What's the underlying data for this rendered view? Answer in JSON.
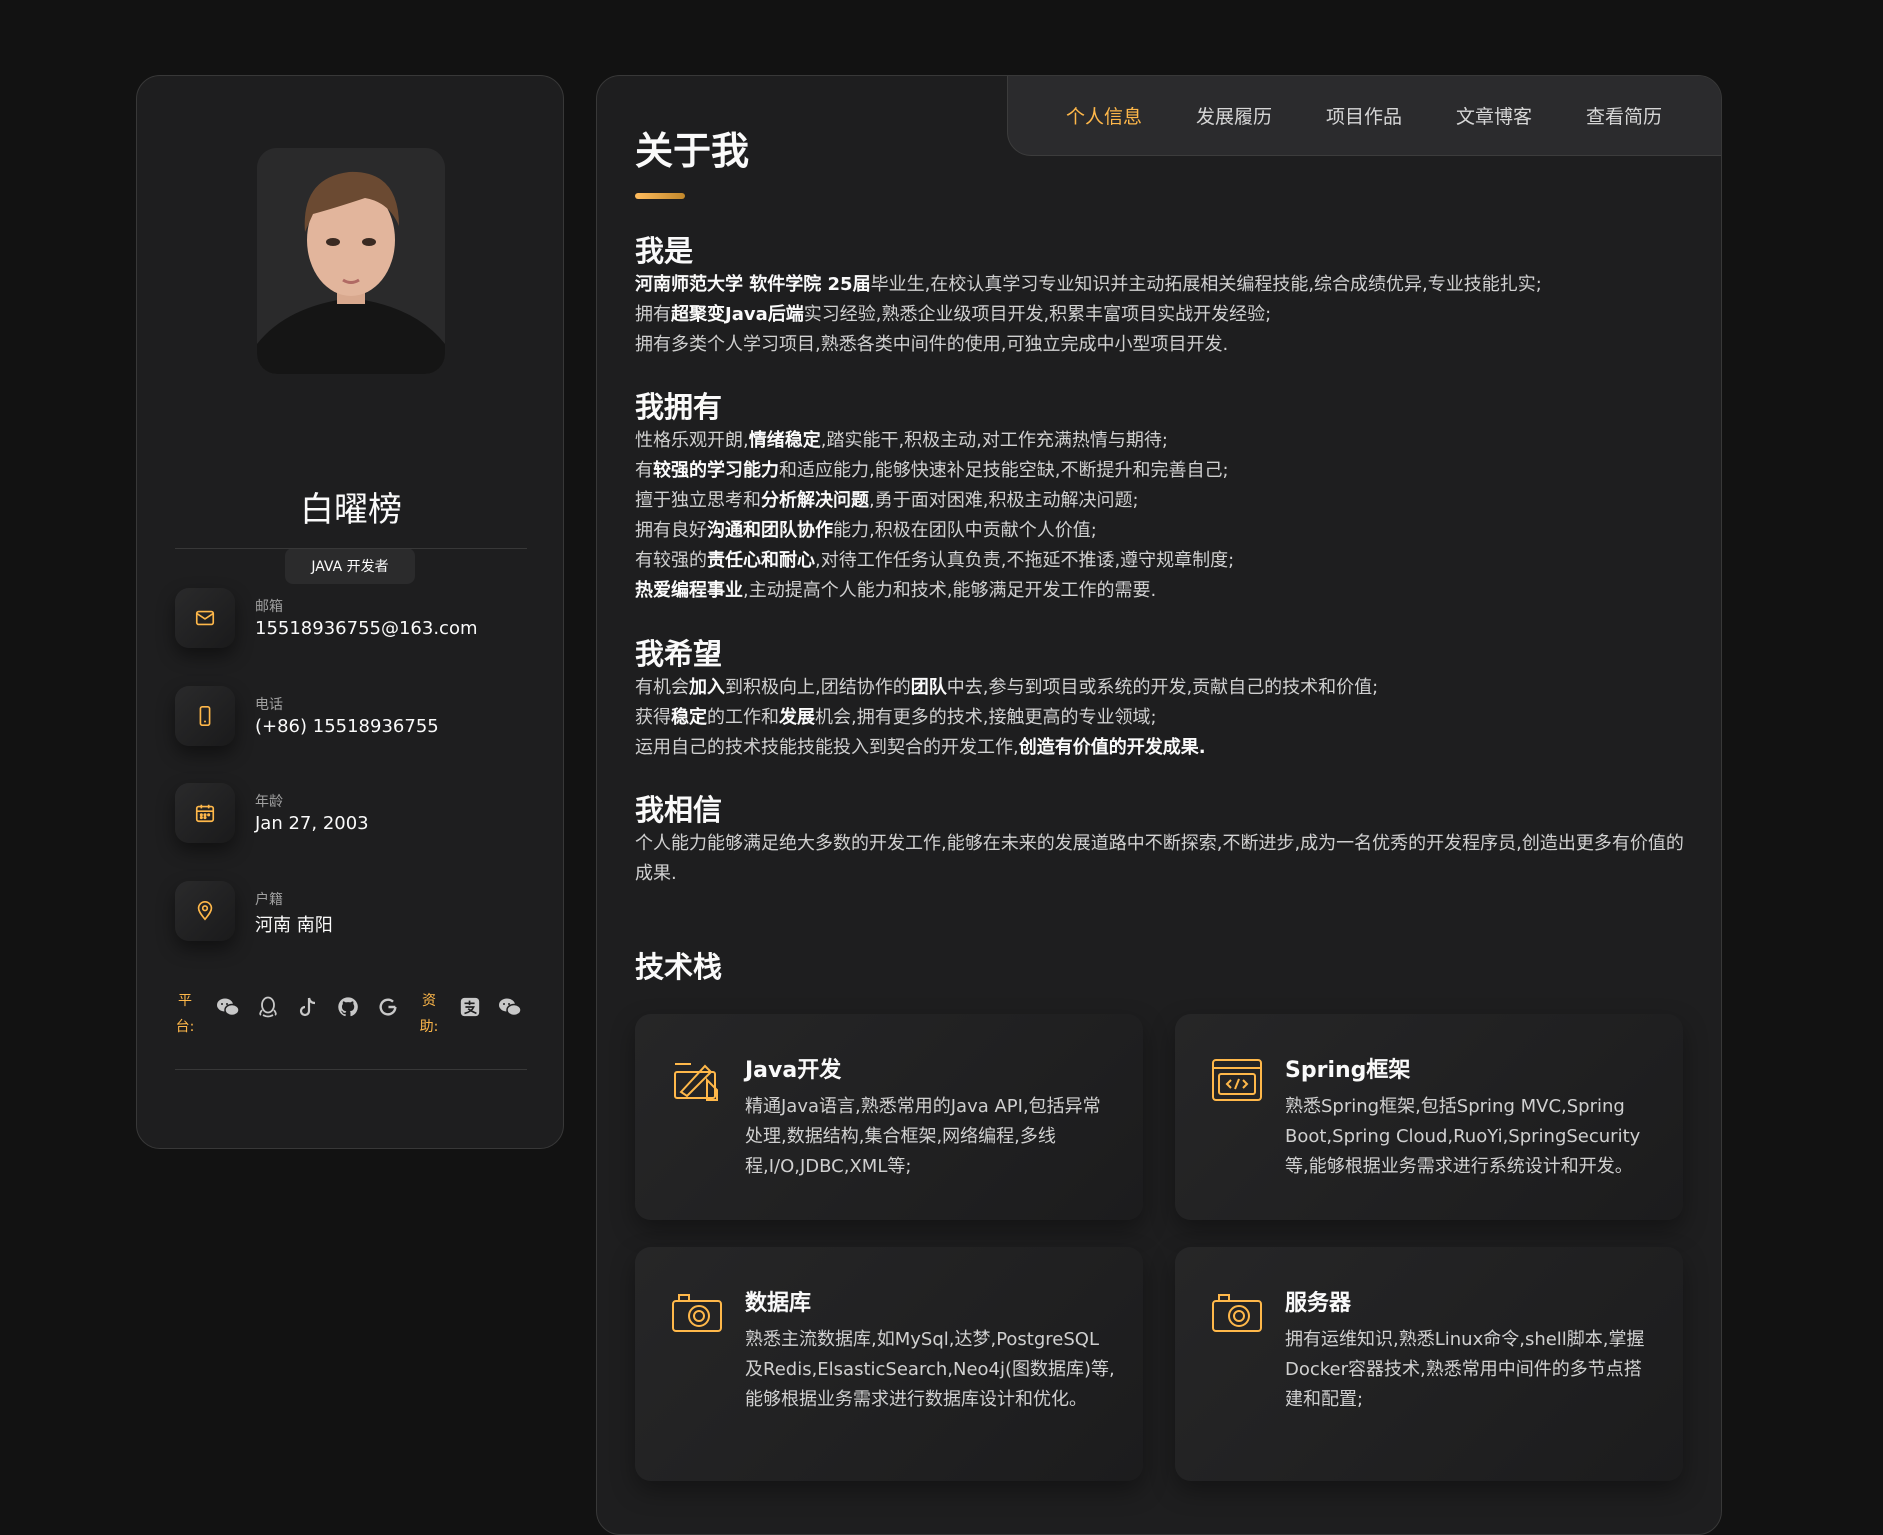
{
  "profile": {
    "name": "白曜榜",
    "title": "JAVA 开发者"
  },
  "contacts": [
    {
      "icon": "mail-icon",
      "title": "邮箱",
      "value": "15518936755@163.com"
    },
    {
      "icon": "phone-icon",
      "title": "电话",
      "value": "(+86) 15518936755"
    },
    {
      "icon": "calendar-icon",
      "title": "年龄",
      "value": "Jan 27, 2003"
    },
    {
      "icon": "location-icon",
      "title": "户籍",
      "value": "河南 南阳"
    }
  ],
  "social": {
    "platform_label": "平台:",
    "platform_icons": [
      "wechat-icon",
      "qq-icon",
      "tiktok-icon",
      "github-icon",
      "google-icon"
    ],
    "sponsor_label": "资助:",
    "sponsor_icons": [
      "alipay-icon",
      "wechat-pay-icon"
    ]
  },
  "nav": {
    "items": [
      "个人信息",
      "发展履历",
      "项目作品",
      "文章博客",
      "查看简历"
    ],
    "active": "个人信息"
  },
  "about": {
    "title": "关于我",
    "sections": [
      {
        "heading": "我是",
        "lines": [
          [
            {
              "t": "河南师范大学 软件学院 25届",
              "b": true
            },
            {
              "t": "毕业生,在校认真学习专业知识并主动拓展相关编程技能,综合成绩优异,专业技能扎实;"
            }
          ],
          [
            {
              "t": "拥有"
            },
            {
              "t": "超聚变Java后端",
              "b": true
            },
            {
              "t": "实习经验,熟悉企业级项目开发,积累丰富项目实战开发经验;"
            }
          ],
          [
            {
              "t": "拥有多类个人学习项目,熟悉各类中间件的使用,可独立完成中小型项目开发."
            }
          ]
        ]
      },
      {
        "heading": "我拥有",
        "lines": [
          [
            {
              "t": "性格乐观开朗,"
            },
            {
              "t": "情绪稳定",
              "b": true
            },
            {
              "t": ",踏实能干,积极主动,对工作充满热情与期待;"
            }
          ],
          [
            {
              "t": "有"
            },
            {
              "t": "较强的学习能力",
              "b": true
            },
            {
              "t": "和适应能力,能够快速补足技能空缺,不断提升和完善自己;"
            }
          ],
          [
            {
              "t": "擅于独立思考和"
            },
            {
              "t": "分析解决问题",
              "b": true
            },
            {
              "t": ",勇于面对困难,积极主动解决问题;"
            }
          ],
          [
            {
              "t": "拥有良好"
            },
            {
              "t": "沟通和团队协作",
              "b": true
            },
            {
              "t": "能力,积极在团队中贡献个人价值;"
            }
          ],
          [
            {
              "t": "有较强的"
            },
            {
              "t": "责任心和耐心",
              "b": true
            },
            {
              "t": ",对待工作任务认真负责,不拖延不推诿,遵守规章制度;"
            }
          ],
          [
            {
              "t": "热爱编程事业",
              "b": true
            },
            {
              "t": ",主动提高个人能力和技术,能够满足开发工作的需要."
            }
          ]
        ]
      },
      {
        "heading": "我希望",
        "lines": [
          [
            {
              "t": "有机会"
            },
            {
              "t": "加入",
              "b": true
            },
            {
              "t": "到积极向上,团结协作的"
            },
            {
              "t": "团队",
              "b": true
            },
            {
              "t": "中去,参与到项目或系统的开发,贡献自己的技术和价值;"
            }
          ],
          [
            {
              "t": "获得"
            },
            {
              "t": "稳定",
              "b": true
            },
            {
              "t": "的工作和"
            },
            {
              "t": "发展",
              "b": true
            },
            {
              "t": "机会,拥有更多的技术,接触更高的专业领域;"
            }
          ],
          [
            {
              "t": "运用自己的技术技能技能投入到契合的开发工作,"
            },
            {
              "t": "创造有价值的开发成果.",
              "b": true
            }
          ]
        ]
      },
      {
        "heading": "我相信",
        "lines": [
          [
            {
              "t": "个人能力能够满足绝大多数的开发工作,能够在未来的发展道路中不断探索,不断进步,成为一名优秀的开发程序员,创造出更多有价值的成果."
            }
          ]
        ]
      }
    ]
  },
  "services": {
    "title": "技术栈",
    "items": [
      {
        "icon": "design-tools-icon",
        "title": "Java开发",
        "text": "精通Java语言,熟悉常用的Java API,包括异常处理,数据结构,集合框架,网络编程,多线程,I/O,JDBC,XML等;"
      },
      {
        "icon": "code-window-icon",
        "title": "Spring框架",
        "text": "熟悉Spring框架,包括Spring MVC,Spring Boot,Spring Cloud,RuoYi,SpringSecurity等,能够根据业务需求进行系统设计和开发。"
      },
      {
        "icon": "camera-icon",
        "title": "数据库",
        "text": "熟悉主流数据库,如MySql,达梦,PostgreSQL及Redis,ElsasticSearch,Neo4j(图数据库)等,能够根据业务需求进行数据库设计和优化。"
      },
      {
        "icon": "camera-icon",
        "title": "服务器",
        "text": "拥有运维知识,熟悉Linux命令,shell脚本,掌握Docker容器技术,熟悉常用中间件的多节点搭建和配置;"
      }
    ]
  },
  "colors": {
    "accent": "#ffb84a",
    "card": "#1e1e1f",
    "background": "#121212"
  }
}
